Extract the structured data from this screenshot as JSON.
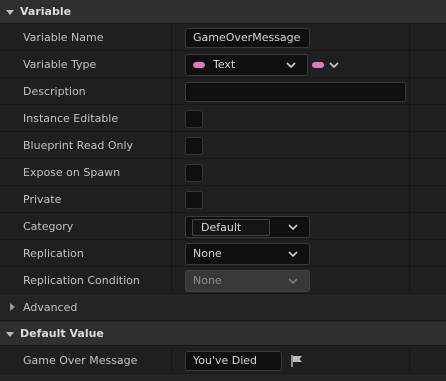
{
  "sections": {
    "variable": {
      "title": "Variable",
      "expanded": true
    },
    "advanced": {
      "title": "Advanced",
      "expanded": false
    },
    "default_value": {
      "title": "Default Value",
      "expanded": true
    }
  },
  "rows": {
    "variable_name": {
      "label": "Variable Name",
      "value": "GameOverMessage"
    },
    "variable_type": {
      "label": "Variable Type",
      "value": "Text",
      "pin_color": "#e07ab6"
    },
    "description": {
      "label": "Description",
      "value": ""
    },
    "instance_editable": {
      "label": "Instance Editable",
      "checked": false
    },
    "blueprint_read_only": {
      "label": "Blueprint Read Only",
      "checked": false
    },
    "expose_on_spawn": {
      "label": "Expose on Spawn",
      "checked": false
    },
    "private": {
      "label": "Private",
      "checked": false
    },
    "category": {
      "label": "Category",
      "value": "Default"
    },
    "replication": {
      "label": "Replication",
      "value": "None"
    },
    "replication_condition": {
      "label": "Replication Condition",
      "value": "None",
      "disabled": true
    },
    "game_over_message": {
      "label": "Game Over Message",
      "value": "You've Died"
    }
  },
  "icons": {
    "section_arrow": "triangle-down-icon",
    "collapsed_arrow": "triangle-right-icon",
    "combo_chevron": "chevron-down-icon",
    "localization": "flag-icon",
    "type_pin": "pill-icon"
  },
  "colors": {
    "text_type_pin": "#e07ab6",
    "panel_bg": "#242424",
    "row_bg": "#1f1f1f",
    "header_bg": "#2f2f2f"
  }
}
